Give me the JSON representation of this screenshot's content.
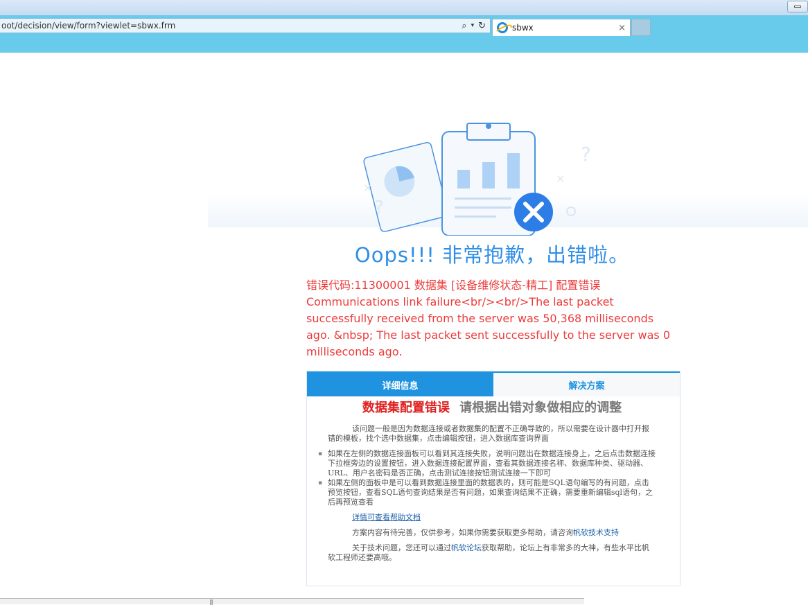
{
  "browser": {
    "url": "oot/decision/view/form?viewlet=sbwx.frm",
    "tab_title": "sbwx",
    "tab_close": "×",
    "search_icon": "search-icon",
    "refresh_icon": "refresh-icon"
  },
  "error": {
    "title": "Oops!!! 非常抱歉，出错啦。",
    "message_line1": "错误代码:11300001 数据集 [设备维修状态-精工] 配置错误",
    "message_line2": "Communications link failure<br/><br/>The last packet successfully received from the server was 50,368 milliseconds ago. &nbsp; The last packet sent successfully to the server was 0 milliseconds ago."
  },
  "panel": {
    "tabs": [
      "详细信息",
      "解决方案"
    ],
    "active_tab": 0,
    "headline_red": "数据集配置错误",
    "headline_grey": "请根据出错对象做相应的调整",
    "intro": "该问题一般是因为数据连接或者数据集的配置不正确导致的，所以需要在设计器中打开报错的模板，找个选中数据集，点击编辑按钮，进入数据库查询界面",
    "bullets": [
      "如果在左侧的数据连接面板可以看到其连接失败，说明问题出在数据连接身上，之后点击数据连接下拉框旁边的设置按钮，进入数据连接配置界面，查看其数据连接名称、数据库种类、驱动器、URL、用户名密码是否正确，点击测试连接按钮测试连接一下即可",
      "如果左侧的面板中是可以看到数据连接里面的数据表的，则可能是SQL语句编写的有问题，点击预览按钮，查看SQL语句查询结果是否有问题，如果查询结果不正确，需要重新编辑sql语句，之后再预览查看"
    ],
    "help_link": "详情可查看帮助文档",
    "support_text": "方案内容有待完善，仅供参考，如果你需要获取更多帮助，请咨询",
    "support_link": "帆软技术支持",
    "forum_text_pre": "关于技术问题，您还可以通过",
    "forum_link": "帆软论坛",
    "forum_text_post": "获取帮助，论坛上有非常多的大神，有些水平比帆软工程师还要高哦。"
  },
  "colors": {
    "accent": "#1f93e0",
    "error": "#ec3b3b",
    "title": "#2f8ee6"
  }
}
